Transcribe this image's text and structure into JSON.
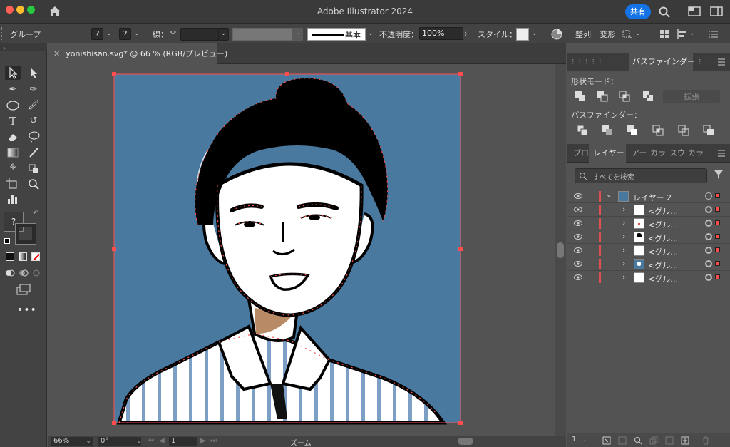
{
  "app": {
    "title": "Adobe Illustrator 2024",
    "share_label": "共有"
  },
  "controlbar": {
    "selection_type": "グループ",
    "fill_question": "?",
    "stroke_question": "?",
    "stroke_label": "線：",
    "stroke_style_label": "基本",
    "opacity_label": "不透明度：",
    "opacity_value": "100%",
    "style_label": "スタイル：",
    "align_label": "整列",
    "transform_label": "変形"
  },
  "document": {
    "tab_title": "yonishisan.svg* @ 66 % (RGB/プレビュー)",
    "artboard_bg": "#4a79a0"
  },
  "status": {
    "zoom": "66%",
    "rotation": "0°",
    "artboard_number": "1",
    "tool_name": "ズーム"
  },
  "toolbox": {
    "swatch_question": "?"
  },
  "pathfinder": {
    "tab_label": "パスファインダー",
    "shape_modes_label": "形状モード：",
    "expand_label": "拡張",
    "pathfinders_label": "パスファインダー："
  },
  "layers_panel": {
    "tabs": [
      "プロ",
      "レイヤー",
      "アー",
      "カラ",
      "スウ",
      "カラ"
    ],
    "search_placeholder": "すべてを検索",
    "layer_name": "レイヤー 2",
    "sublayers": [
      {
        "name": "<グル…"
      },
      {
        "name": "<グル…"
      },
      {
        "name": "<グル…"
      },
      {
        "name": "<グル…"
      },
      {
        "name": "<グル…"
      },
      {
        "name": "<グル…"
      }
    ],
    "layer_count": "1 ..."
  },
  "colors": {
    "accent": "#1473e6",
    "selection": "#ff4d4d",
    "skin": "#b98a66"
  }
}
